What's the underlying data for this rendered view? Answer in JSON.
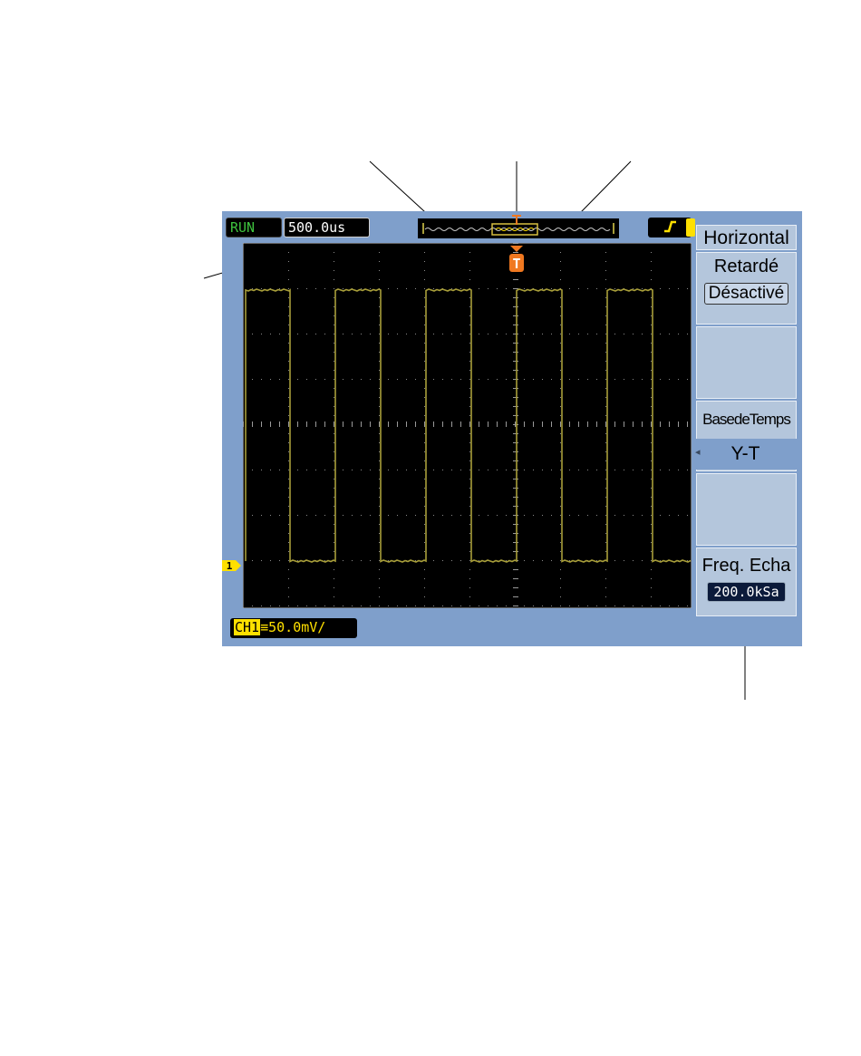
{
  "status": {
    "run_state": "RUN",
    "timebase": "500.0us",
    "trigger_slope_icon": "rising-edge-icon",
    "trigger_marker": "T"
  },
  "channel": {
    "label": "CH1",
    "coupling_icon": "dc-coupling-icon",
    "scale": "50.0mV/",
    "ground_marker": "1"
  },
  "menu": {
    "title": "Horizontal",
    "delayed_label": "Retardé",
    "delayed_value": "Désactivé",
    "timebase_label": "BasedeTemps",
    "timebase_value": "Y-T",
    "sample_rate_label": "Freq. Echa",
    "sample_rate_value": "200.0kSa"
  },
  "colors": {
    "bezel": "#7f9fcb",
    "trace": "#a89e3a",
    "trigger": "#f07820",
    "run": "#3ec23e",
    "channel": "#ffe000"
  }
}
